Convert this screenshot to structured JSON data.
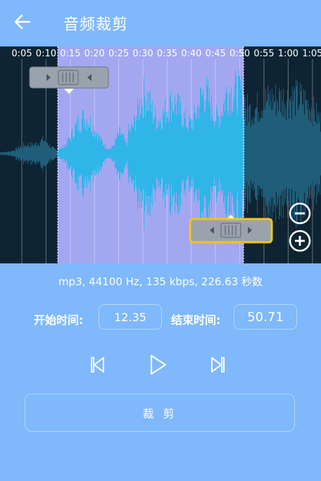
{
  "header": {
    "title": "音频裁剪"
  },
  "timeline": {
    "ticks": [
      "0:05",
      "0:10",
      "0:15",
      "0:20",
      "0:25",
      "0:30",
      "0:35",
      "0:40",
      "0:45",
      "0:50",
      "0:55",
      "1:00",
      "1:05"
    ]
  },
  "selection": {
    "start_seconds": 12.35,
    "end_seconds": 50.71
  },
  "info": {
    "text": "mp3, 44100 Hz, 135 kbps, 226.63 秒数"
  },
  "fields": {
    "start_label": "开始时间:",
    "start_value": "12.35",
    "end_label": "结束时间:",
    "end_value": "50.71"
  },
  "actions": {
    "trim_label": "裁 剪"
  },
  "colors": {
    "background": "#7fb8fb",
    "wave_bg": "#0e2433",
    "selection": "#a3a7f0",
    "waveform": "#2fb5e8",
    "waveform_dim": "#1f5d78",
    "end_handle_border": "#f5c518"
  }
}
